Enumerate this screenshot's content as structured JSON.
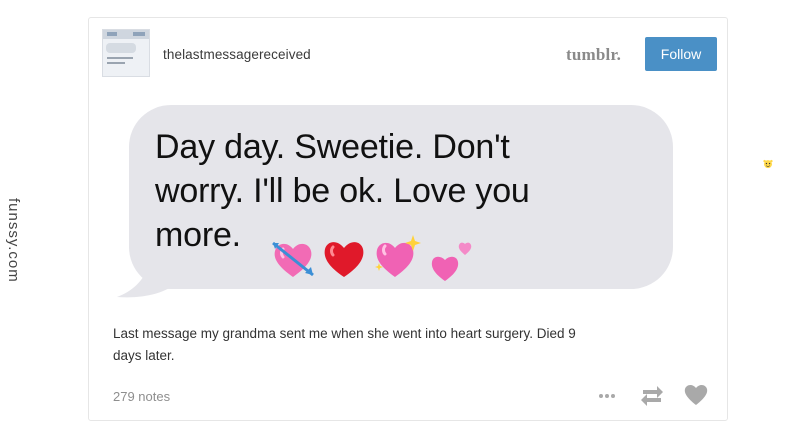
{
  "post": {
    "blog_name": "thelastmessagereceived",
    "platform_logo": "tumblr.",
    "follow_label": "Follow",
    "message_lines": [
      "Day day. Sweetie. Don't",
      "worry. I'll be ok. Love you",
      "more."
    ],
    "message_emojis": [
      "heart-with-arrow-icon",
      "red-heart-icon",
      "sparkling-heart-icon",
      "two-hearts-icon"
    ],
    "caption_lines": [
      "Last message my grandma sent me when she went into heart surgery. Died 9",
      "days later."
    ],
    "notes": "279 notes",
    "actions": [
      "more-options-icon",
      "reblog-icon",
      "like-heart-icon"
    ]
  },
  "watermark": {
    "text": "funssy.com",
    "icon": "mascot-icon"
  },
  "colors": {
    "follow_button": "#4a90c6",
    "message_bubble": "#e5e5ea",
    "text_dark": "#111111",
    "meta_gray": "#8e8e8e"
  }
}
